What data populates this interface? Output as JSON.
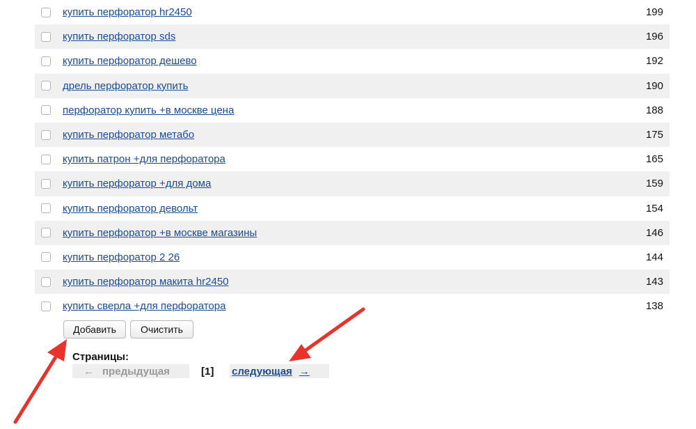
{
  "keywords": [
    {
      "phrase": "купить перфоратор hr2450",
      "count": "199"
    },
    {
      "phrase": "купить перфоратор sds",
      "count": "196"
    },
    {
      "phrase": "купить перфоратор дешево",
      "count": "192"
    },
    {
      "phrase": "дрель перфоратор купить",
      "count": "190"
    },
    {
      "phrase": "перфоратор купить +в москве цена",
      "count": "188"
    },
    {
      "phrase": "купить перфоратор метабо",
      "count": "175"
    },
    {
      "phrase": "купить патрон +для перфоратора",
      "count": "165"
    },
    {
      "phrase": "купить перфоратор +для дома",
      "count": "159"
    },
    {
      "phrase": "купить перфоратор девольт",
      "count": "154"
    },
    {
      "phrase": "купить перфоратор +в москве магазины",
      "count": "146"
    },
    {
      "phrase": "купить перфоратор 2 26",
      "count": "144"
    },
    {
      "phrase": "купить перфоратор макита hr2450",
      "count": "143"
    },
    {
      "phrase": "купить сверла +для перфоратора",
      "count": "138"
    }
  ],
  "buttons": {
    "add_label": "Добавить",
    "clear_label": "Очистить"
  },
  "pagination": {
    "label": "Страницы:",
    "prev_arrow": "←",
    "prev_label": "предыдущая",
    "current": "[1]",
    "next_label": "следующая",
    "next_arrow": "→"
  },
  "colors": {
    "link": "#1a4a9c",
    "row_alt": "#f0f0f0",
    "annotation_arrow": "#e8332a"
  },
  "icons": {
    "annotation": "red-pointer-arrow"
  }
}
